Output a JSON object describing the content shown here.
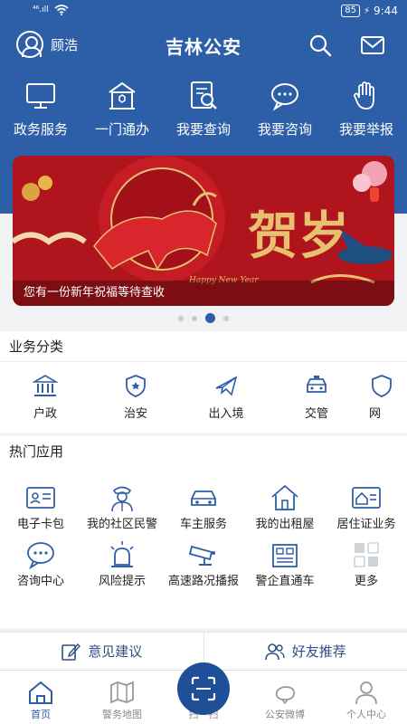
{
  "status": {
    "signal": "⁴⁶.ıll",
    "battery": "85",
    "time": "9:44"
  },
  "header": {
    "username": "顾浩",
    "title": "吉林公安"
  },
  "quick_actions": [
    {
      "label": "政务服务",
      "icon": "monitor-icon"
    },
    {
      "label": "一门通办",
      "icon": "police-building-icon"
    },
    {
      "label": "我要查询",
      "icon": "search-document-icon"
    },
    {
      "label": "我要咨询",
      "icon": "chat-bubble-icon"
    },
    {
      "label": "我要举报",
      "icon": "hand-icon"
    }
  ],
  "banner": {
    "caption": "您有一份新年祝福等待查收",
    "art_text": "贺岁",
    "art_sub": "Happy New Year"
  },
  "carousel": {
    "count": 4,
    "active": 3
  },
  "categories": {
    "title": "业务分类",
    "items": [
      {
        "label": "户政",
        "icon": "bank-icon"
      },
      {
        "label": "治安",
        "icon": "police-badge-icon"
      },
      {
        "label": "出入境",
        "icon": "airplane-icon"
      },
      {
        "label": "交管",
        "icon": "police-car-icon"
      },
      {
        "label": "网",
        "icon": "network-icon"
      }
    ]
  },
  "hot_apps": {
    "title": "热门应用",
    "items": [
      {
        "label": "电子卡包",
        "icon": "id-card-icon"
      },
      {
        "label": "我的社区民警",
        "icon": "police-officer-icon"
      },
      {
        "label": "车主服务",
        "icon": "car-icon"
      },
      {
        "label": "我的出租屋",
        "icon": "house-icon"
      },
      {
        "label": "居住证业务",
        "icon": "residence-card-icon"
      },
      {
        "label": "咨询中心",
        "icon": "chat-icon"
      },
      {
        "label": "风险提示",
        "icon": "alarm-light-icon"
      },
      {
        "label": "高速路况播报",
        "icon": "cctv-camera-icon"
      },
      {
        "label": "警企直通车",
        "icon": "office-building-icon"
      },
      {
        "label": "更多",
        "icon": "grid-more-icon"
      }
    ]
  },
  "feedback": {
    "suggestion": "意见建议",
    "recommend": "好友推荐"
  },
  "tabbar": [
    {
      "label": "首页",
      "icon": "home-icon",
      "active": true
    },
    {
      "label": "警务地图",
      "icon": "map-icon",
      "active": false
    },
    {
      "label": "扫一扫",
      "icon": "scan-icon",
      "active": false
    },
    {
      "label": "公安微博",
      "icon": "weibo-icon",
      "active": false
    },
    {
      "label": "个人中心",
      "icon": "person-icon",
      "active": false
    }
  ],
  "colors": {
    "primary": "#2d5ea8",
    "banner_red": "#b0141c",
    "gold": "#e8c070"
  }
}
